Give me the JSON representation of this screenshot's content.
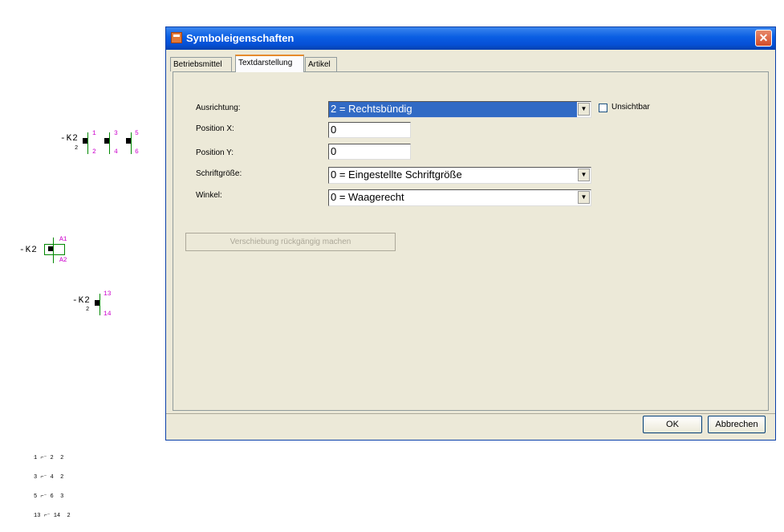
{
  "schematic": {
    "contactor_group": {
      "label": "-K2",
      "sub": "2",
      "pins_top": [
        "1",
        "3",
        "5"
      ],
      "pins_bottom": [
        "2",
        "4",
        "6"
      ]
    },
    "coil": {
      "label": "-K2",
      "pin_top": "A1",
      "pin_bottom": "A2"
    },
    "aux_contact": {
      "label": "-K2",
      "sub": "2",
      "pin_top": "13",
      "pin_bottom": "14"
    },
    "cross_ref": [
      "1 ⌐⁻ 2  2",
      "3 ⌐⁻ 4  2",
      "5 ⌐⁻ 6  3",
      "13 ⌐⁻ 14  2"
    ]
  },
  "dialog": {
    "title": "Symboleigenschaften",
    "close_glyph": "✕",
    "tabs": [
      "Betriebsmittel",
      "Textdarstellung",
      "Artikel"
    ],
    "active_tab": "Textdarstellung",
    "fields": {
      "ausrichtung": {
        "label": "Ausrichtung:",
        "value": "2 = Rechtsbündig"
      },
      "unsichtbar": {
        "label": "Unsichtbar",
        "checked": false
      },
      "position_x": {
        "label": "Position X:",
        "value": "0"
      },
      "position_y": {
        "label": "Position Y:",
        "value": "0"
      },
      "schriftgroesse": {
        "label": "Schriftgröße:",
        "value": "0 = Eingestellte Schriftgröße"
      },
      "winkel": {
        "label": "Winkel:",
        "value": "0 = Waagerecht"
      }
    },
    "undo_button": "Verschiebung rückgängig machen",
    "ok_button": "OK",
    "cancel_button": "Abbrechen",
    "dropdown_glyph": "▼"
  }
}
